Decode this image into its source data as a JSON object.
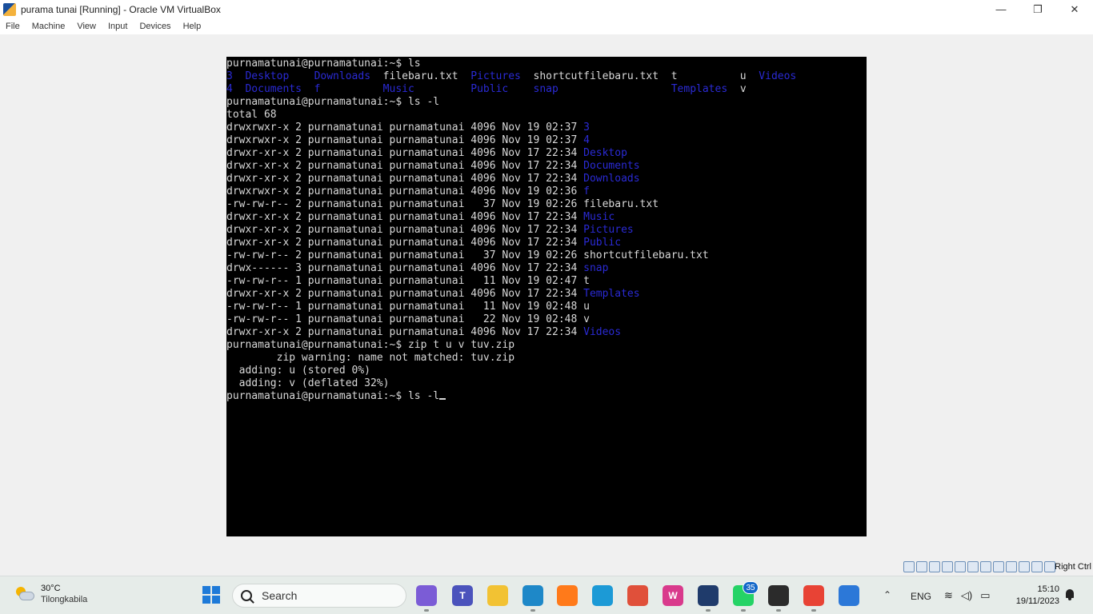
{
  "window": {
    "title": "purama tunai [Running] - Oracle VM VirtualBox",
    "controls": {
      "minimize": "—",
      "restore": "❐",
      "close": "✕"
    }
  },
  "menu": [
    "File",
    "Machine",
    "View",
    "Input",
    "Devices",
    "Help"
  ],
  "terminal": {
    "lines": [
      [
        {
          "t": "purnamatunai@purnamatunai:~$ ls",
          "c": "w"
        }
      ],
      [
        {
          "t": "3  ",
          "c": "b"
        },
        {
          "t": "Desktop    ",
          "c": "b"
        },
        {
          "t": "Downloads  ",
          "c": "b"
        },
        {
          "t": "filebaru.txt  ",
          "c": "w"
        },
        {
          "t": "Pictures  ",
          "c": "b"
        },
        {
          "t": "shortcutfilebaru.txt  t          u  ",
          "c": "w"
        },
        {
          "t": "Videos",
          "c": "b"
        }
      ],
      [
        {
          "t": "4  ",
          "c": "b"
        },
        {
          "t": "Documents  ",
          "c": "b"
        },
        {
          "t": "f          ",
          "c": "b"
        },
        {
          "t": "Music         ",
          "c": "b"
        },
        {
          "t": "Public    ",
          "c": "b"
        },
        {
          "t": "snap                  ",
          "c": "b"
        },
        {
          "t": "Templates  ",
          "c": "b"
        },
        {
          "t": "v",
          "c": "w"
        }
      ],
      [
        {
          "t": "purnamatunai@purnamatunai:~$ ls -l",
          "c": "w"
        }
      ],
      [
        {
          "t": "total 68",
          "c": "w"
        }
      ],
      [
        {
          "t": "drwxrwxr-x 2 purnamatunai purnamatunai 4096 Nov 19 02:37 ",
          "c": "w"
        },
        {
          "t": "3",
          "c": "b"
        }
      ],
      [
        {
          "t": "drwxrwxr-x 2 purnamatunai purnamatunai 4096 Nov 19 02:37 ",
          "c": "w"
        },
        {
          "t": "4",
          "c": "b"
        }
      ],
      [
        {
          "t": "drwxr-xr-x 2 purnamatunai purnamatunai 4096 Nov 17 22:34 ",
          "c": "w"
        },
        {
          "t": "Desktop",
          "c": "b"
        }
      ],
      [
        {
          "t": "drwxr-xr-x 2 purnamatunai purnamatunai 4096 Nov 17 22:34 ",
          "c": "w"
        },
        {
          "t": "Documents",
          "c": "b"
        }
      ],
      [
        {
          "t": "drwxr-xr-x 2 purnamatunai purnamatunai 4096 Nov 17 22:34 ",
          "c": "w"
        },
        {
          "t": "Downloads",
          "c": "b"
        }
      ],
      [
        {
          "t": "drwxrwxr-x 2 purnamatunai purnamatunai 4096 Nov 19 02:36 ",
          "c": "w"
        },
        {
          "t": "f",
          "c": "b"
        }
      ],
      [
        {
          "t": "-rw-rw-r-- 2 purnamatunai purnamatunai   37 Nov 19 02:26 filebaru.txt",
          "c": "w"
        }
      ],
      [
        {
          "t": "drwxr-xr-x 2 purnamatunai purnamatunai 4096 Nov 17 22:34 ",
          "c": "w"
        },
        {
          "t": "Music",
          "c": "b"
        }
      ],
      [
        {
          "t": "drwxr-xr-x 2 purnamatunai purnamatunai 4096 Nov 17 22:34 ",
          "c": "w"
        },
        {
          "t": "Pictures",
          "c": "b"
        }
      ],
      [
        {
          "t": "drwxr-xr-x 2 purnamatunai purnamatunai 4096 Nov 17 22:34 ",
          "c": "w"
        },
        {
          "t": "Public",
          "c": "b"
        }
      ],
      [
        {
          "t": "-rw-rw-r-- 2 purnamatunai purnamatunai   37 Nov 19 02:26 shortcutfilebaru.txt",
          "c": "w"
        }
      ],
      [
        {
          "t": "drwx------ 3 purnamatunai purnamatunai 4096 Nov 17 22:34 ",
          "c": "w"
        },
        {
          "t": "snap",
          "c": "b"
        }
      ],
      [
        {
          "t": "-rw-rw-r-- 1 purnamatunai purnamatunai   11 Nov 19 02:47 t",
          "c": "w"
        }
      ],
      [
        {
          "t": "drwxr-xr-x 2 purnamatunai purnamatunai 4096 Nov 17 22:34 ",
          "c": "w"
        },
        {
          "t": "Templates",
          "c": "b"
        }
      ],
      [
        {
          "t": "-rw-rw-r-- 1 purnamatunai purnamatunai   11 Nov 19 02:48 u",
          "c": "w"
        }
      ],
      [
        {
          "t": "-rw-rw-r-- 1 purnamatunai purnamatunai   22 Nov 19 02:48 v",
          "c": "w"
        }
      ],
      [
        {
          "t": "drwxr-xr-x 2 purnamatunai purnamatunai 4096 Nov 17 22:34 ",
          "c": "w"
        },
        {
          "t": "Videos",
          "c": "b"
        }
      ],
      [
        {
          "t": "purnamatunai@purnamatunai:~$ zip t u v tuv.zip",
          "c": "w"
        }
      ],
      [
        {
          "t": "        zip warning: name not matched: tuv.zip",
          "c": "w"
        }
      ],
      [
        {
          "t": "  adding: u (stored 0%)",
          "c": "w"
        }
      ],
      [
        {
          "t": "  adding: v (deflated 32%)",
          "c": "w"
        }
      ],
      [
        {
          "t": "purnamatunai@purnamatunai:~$ ls -l",
          "c": "w"
        }
      ]
    ],
    "colors": {
      "text": "#d8d8d8",
      "directory": "#2a2ad4",
      "background": "#000000"
    }
  },
  "statusbar": {
    "icon_names": [
      "hard-disk-icon",
      "optical-drive-icon",
      "audio-icon",
      "network-icon",
      "usb-icon",
      "shared-folders-icon",
      "display-icon",
      "video-capture-icon",
      "recording-icon",
      "cpu-icon",
      "mouse-integration-icon",
      "keyboard-capture-icon"
    ],
    "host_key": "Right Ctrl"
  },
  "taskbar": {
    "weather": {
      "temp": "30°C",
      "location": "Tilongkabila"
    },
    "search_placeholder": "Search",
    "apps": [
      {
        "name": "copilot-pre",
        "label": "",
        "color": "#7b5cd6"
      },
      {
        "name": "teams",
        "label": "T",
        "color": "#4b53bc"
      },
      {
        "name": "file-explorer",
        "label": "",
        "color": "#f2c233"
      },
      {
        "name": "vscode-like",
        "label": "",
        "color": "#1e88c8"
      },
      {
        "name": "firefox",
        "label": "",
        "color": "#ff7a1a"
      },
      {
        "name": "edge",
        "label": "",
        "color": "#1c9ad6"
      },
      {
        "name": "snipping-tool",
        "label": "",
        "color": "#e0503a"
      },
      {
        "name": "wps-office",
        "label": "W",
        "color": "#d93a8c"
      },
      {
        "name": "virtualbox",
        "label": "",
        "color": "#1f3b6b"
      },
      {
        "name": "whatsapp",
        "label": "",
        "color": "#25d366"
      },
      {
        "name": "notepad-dark",
        "label": "",
        "color": "#2b2b2b"
      },
      {
        "name": "chrome",
        "label": "",
        "color": "#e84335"
      },
      {
        "name": "photos",
        "label": "",
        "color": "#2c78d8"
      }
    ],
    "whatsapp_badge": "35",
    "tray": {
      "chevron": "⌃",
      "language": "ENG"
    },
    "clock": {
      "time": "15:10",
      "date": "19/11/2023"
    }
  }
}
